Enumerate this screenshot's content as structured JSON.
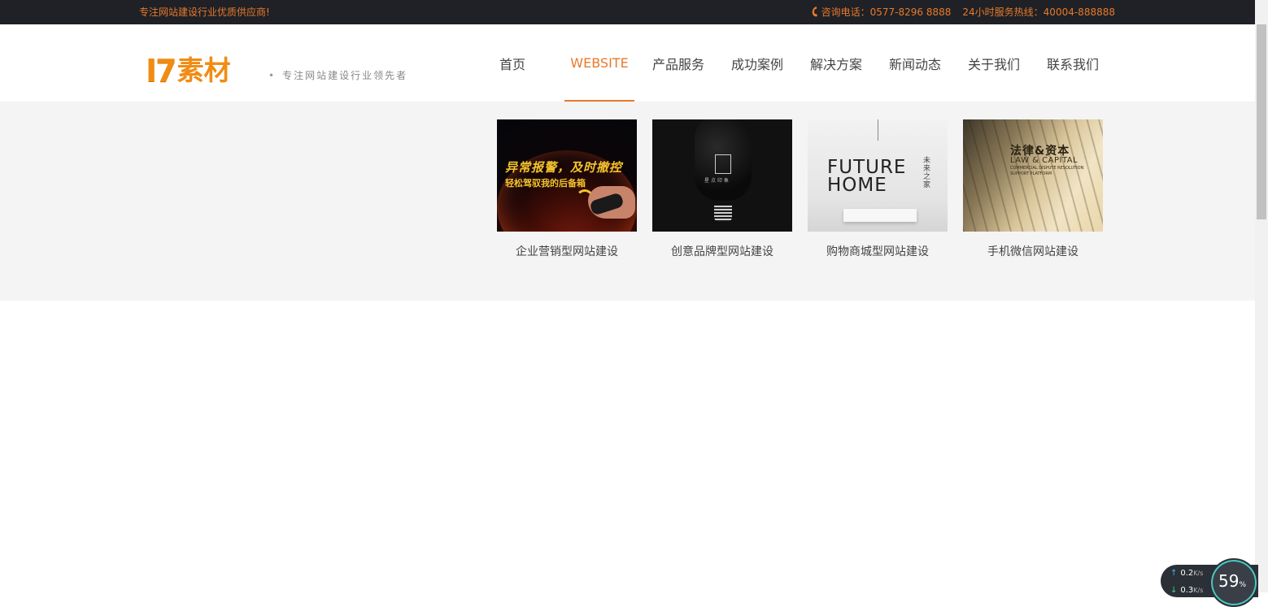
{
  "topbar": {
    "slogan": "专注网站建设行业优质供应商!",
    "phone_label": "咨询电话：0577-8296 8888",
    "hotline_label": "24小时服务热线：40004-888888"
  },
  "header": {
    "logo_mark": "I7",
    "logo_word": "素材",
    "tagline": "专注网站建设行业领先者"
  },
  "nav": [
    {
      "label": "首页",
      "active": false
    },
    {
      "label": "WEBSITE",
      "active": true
    },
    {
      "label": "产品服务",
      "active": false
    },
    {
      "label": "成功案例",
      "active": false
    },
    {
      "label": "解决方案",
      "active": false
    },
    {
      "label": "新闻动态",
      "active": false
    },
    {
      "label": "关于我们",
      "active": false
    },
    {
      "label": "联系我们",
      "active": false
    }
  ],
  "dropdown": {
    "cards": [
      {
        "caption": "企业营销型网站建设",
        "img_text_1": "异常报警，及时撤控",
        "img_text_2": "轻松驾驭我的后备箱"
      },
      {
        "caption": "创意品牌型网站建设",
        "img_text_1": "星点印象"
      },
      {
        "caption": "购物商城型网站建设",
        "img_text_1": "FUTURE",
        "img_text_2": "HOME",
        "img_text_3": "未来之家"
      },
      {
        "caption": "手机微信网站建设",
        "img_text_1": "法律&资本",
        "img_text_2": "LAW & CAPITAL",
        "img_text_3": "COMMERCIAL DISPUTE RESOLUTION SUPPORT PLATFORM"
      }
    ]
  },
  "netwidget": {
    "upload": "0.2",
    "download": "0.3",
    "unit": "K/s",
    "percent": "59",
    "percent_sign": "%"
  },
  "colors": {
    "accent": "#e8792a",
    "topbar_bg": "#1f2126",
    "panel_bg": "#f4f4f4"
  }
}
